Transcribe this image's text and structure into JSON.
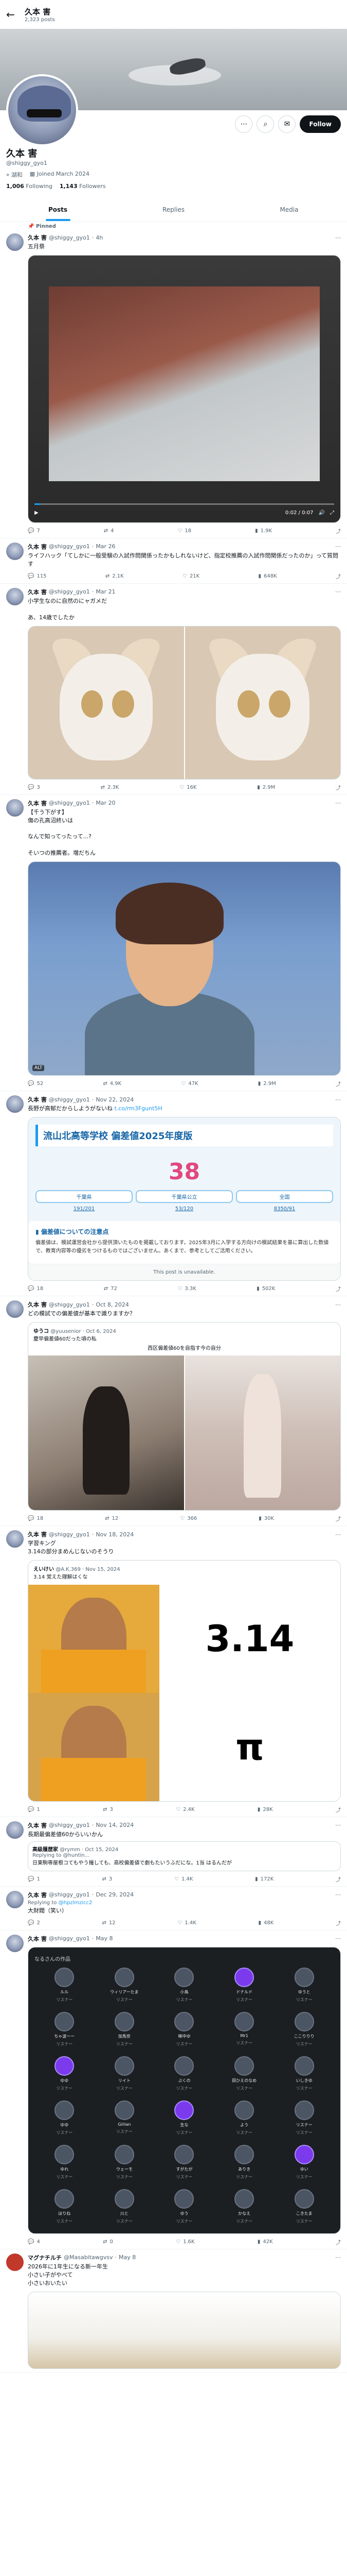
{
  "header": {
    "name": "久本 害",
    "posts_count": "2,323 posts"
  },
  "profile": {
    "name": "久本 害",
    "handle": "@shiggy_gyo1",
    "location": "湖和",
    "joined": "Joined March 2024",
    "following": "1,006",
    "following_label": "Following",
    "followers": "1,143",
    "followers_label": "Followers",
    "follow_label": "Follow"
  },
  "tabs": [
    "Posts",
    "Replies",
    "Media"
  ],
  "pinned_label": "Pinned",
  "posts": [
    {
      "name": "久本 害",
      "handle": "@shiggy_gyo1",
      "time": "4h",
      "text": "五月祭",
      "reply": "7",
      "repost": "4",
      "like": "18",
      "views": "1.9K",
      "video_time": "0:02 / 0:07"
    },
    {
      "name": "久本 害",
      "handle": "@shiggy_gyo1",
      "time": "Mar 26",
      "text": "ライフハック「てしかに一般受験の入試作問関係ったかもしれないけど、指定校推薦の入試作問関係だったのか」って質問す",
      "reply": "115",
      "repost": "2.1K",
      "like": "21K",
      "views": "648K"
    },
    {
      "name": "久本 害",
      "handle": "@shiggy_gyo1",
      "time": "Mar 21",
      "text": "小学生なのに自然のにャガメだ\n\nあ、14歳でしたか",
      "reply": "3",
      "repost": "2.3K",
      "like": "16K",
      "views": "2.9M"
    },
    {
      "name": "久本 害",
      "handle": "@shiggy_gyo1",
      "time": "Mar 20",
      "text": "【千う下がす】\n傷の孔高沼終いは\n\nなんで知ってったって...?\n\nそいつの推薦者。増だちん",
      "reply": "52",
      "repost": "4.9K",
      "like": "47K",
      "views": "2.9M",
      "image_tag": "ALT"
    },
    {
      "name": "久本 害",
      "handle": "@shiggy_gyo1",
      "time": "Nov 22, 2024",
      "text": "長野が高郁だからしようがないね",
      "link": "t.co/rm3Fgunt5H",
      "school": {
        "title": "流山北高等学校 偏差値2025年度版",
        "score": "38",
        "cols": [
          "千葉県",
          "千葉県公立",
          "全国"
        ],
        "nums": [
          "191/201",
          "53/120",
          "8350/91"
        ],
        "notice_title": "偏差値についての注意点",
        "notice_text": "偏差値は、模試運営会社から提供頂いたものを掲載しております。2025年3月に入学する方向けの模試結果を基に算出した数値で、教育内容等の優劣をつけるものではございません。あくまで、参考としてご活用ください。"
      },
      "unavailable": "This post is unavailable.",
      "reply": "18",
      "repost": "72",
      "like": "3.3K",
      "views": "502K"
    },
    {
      "name": "久本 害",
      "handle": "@shiggy_gyo1",
      "time": "Oct 8, 2024",
      "text": "どの模試での偏差値が基本で識りますか？",
      "quote_name": "ゆうコ",
      "quote_handle": "@yuusenior",
      "quote_time": "Oct 6, 2024",
      "quote_text": "慶早偏差値60だった頃の私",
      "quote_caption": "西区偏差値60を自指す今の自分",
      "reply": "18",
      "repost": "12",
      "like": "366",
      "views": "30K"
    },
    {
      "name": "久本 害",
      "handle": "@shiggy_gyo1",
      "time": "Nov 18, 2024",
      "text": "学習キング\n3.14の部分まめんじないのそうり",
      "quote_name": "えいけい",
      "quote_handle": "@A.K.369",
      "quote_time": "Nov 15, 2024",
      "quote_text": "3.14 覚えた理解はくな",
      "meme_top": "3.14",
      "meme_bottom": "π",
      "reply": "1",
      "repost": "3",
      "like": "2.4K",
      "views": "28K"
    },
    {
      "name": "久本 害",
      "handle": "@shiggy_gyo1",
      "time": "Nov 14, 2024",
      "text": "長期最偏差値60からいいかん",
      "nested_name": "高級履歴家",
      "nested_handle": "@rymm",
      "nested_time": "Oct 15, 2024",
      "nested_reply": "Replying to @huntin... ",
      "nested_text": "日東駒専屋根コてもやう撮しても、高校偏差値で劇もたいうふだにな。1当\nはるんだが",
      "reply": "1",
      "repost": "3",
      "like": "1.4K",
      "views": "172K"
    },
    {
      "name": "久本 害",
      "handle": "@shiggy_gyo1",
      "time": "Dec 29, 2024",
      "text": "大財閥（笑い）",
      "reply_to": "@hpzlmzicc2",
      "reply": "2",
      "repost": "12",
      "like": "1.4K",
      "views": "48K"
    },
    {
      "name": "久本 害",
      "handle": "@shiggy_gyo1",
      "time": "May 8",
      "text": "",
      "lb_title": "なるさんの作品",
      "lb_items": [
        {
          "name": "ルル",
          "role": "リスナー"
        },
        {
          "name": "ウィリアーたま",
          "role": "リスナー"
        },
        {
          "name": "小鳥",
          "role": "リスナー"
        },
        {
          "name": "ドナルド",
          "role": "リスナー"
        },
        {
          "name": "ゆうと",
          "role": "リスナー"
        },
        {
          "name": "ちゃ波ーー",
          "role": "リスナー"
        },
        {
          "name": "加馬奈",
          "role": "リスナー"
        },
        {
          "name": "稀中ゆ",
          "role": "リスナー"
        },
        {
          "name": "Mr1",
          "role": "リスナー"
        },
        {
          "name": "ここりりり",
          "role": "リスナー"
        },
        {
          "name": "ゆゆ",
          "role": "リスナー"
        },
        {
          "name": "リイト",
          "role": "リスナー"
        },
        {
          "name": "ぶくの",
          "role": "リスナー"
        },
        {
          "name": "田ひえのなめ",
          "role": "リスナー"
        },
        {
          "name": "いしきゆ",
          "role": "リスナー"
        },
        {
          "name": "ゆゆ",
          "role": "リスナー"
        },
        {
          "name": "Gillian",
          "role": "リスナー"
        },
        {
          "name": "生な",
          "role": "リスナー"
        },
        {
          "name": "よう",
          "role": "リスナー"
        },
        {
          "name": "リスナー",
          "role": "リスナー"
        },
        {
          "name": "ゆれ",
          "role": "リスナー"
        },
        {
          "name": "ウェーモ",
          "role": "リスナー"
        },
        {
          "name": "すがたが",
          "role": "リスナー"
        },
        {
          "name": "ありき",
          "role": "リスナー"
        },
        {
          "name": "ゆい",
          "role": "リスナー"
        },
        {
          "name": "ほりね",
          "role": "リスナー"
        },
        {
          "name": "川と",
          "role": "リスナー"
        },
        {
          "name": "ゆう",
          "role": "リスナー"
        },
        {
          "name": "かなえ",
          "role": "リスナー"
        },
        {
          "name": "こきたま",
          "role": "リスナー"
        }
      ],
      "reply": "4",
      "repost": "0",
      "like": "1.6K",
      "views": "42K"
    },
    {
      "name": "マグナチルチ",
      "handle": "@Masabitawgvsv",
      "time": "May 8",
      "text": "2026年に1年生になる新一年生\n小さい子がやべて\n小さいおいたい",
      "nested_name": "",
      "reply": "",
      "repost": "",
      "like": "",
      "views": ""
    }
  ],
  "colors": {
    "accent": "#1d9bf0",
    "text": "#0f1419",
    "muted": "#536471",
    "border": "#eff3f4",
    "score": "#e0487e"
  }
}
